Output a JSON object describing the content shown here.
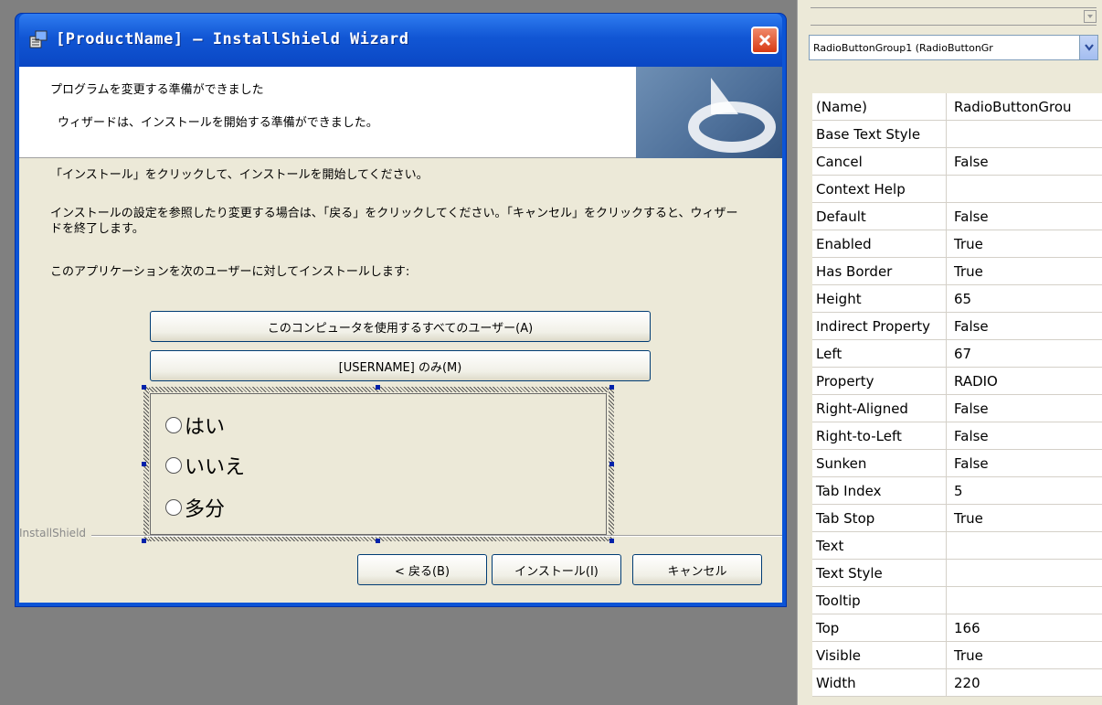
{
  "window": {
    "title": "[ProductName] – InstallShield Wizard"
  },
  "banner": {
    "title": "プログラムを変更する準備ができました",
    "subtitle": "ウィザードは、インストールを開始する準備ができました。"
  },
  "body": {
    "instruction1": "「インストール」をクリックして、インストールを開始してください。",
    "instruction2": "インストールの設定を参照したり変更する場合は、「戻る」をクリックしてください。「キャンセル」をクリックすると、ウィザードを終了します。",
    "instruction3": "このアプリケーションを次のユーザーに対してインストールします:"
  },
  "options": {
    "all_users": "このコンピュータを使用するすべてのユーザー(A)",
    "only_user": "[USERNAME] のみ(M)"
  },
  "radio_group": {
    "items": [
      "はい",
      "いいえ",
      "多分"
    ]
  },
  "brand": "InstallShield",
  "buttons": {
    "back": "< 戻る(B)",
    "install": "インストール(I)",
    "cancel": "キャンセル"
  },
  "property_grid": {
    "selected_object": "RadioButtonGroup1  (RadioButtonGr",
    "rows": [
      {
        "name": "(Name)",
        "value": "RadioButtonGrou"
      },
      {
        "name": "Base Text Style",
        "value": ""
      },
      {
        "name": "Cancel",
        "value": "False"
      },
      {
        "name": "Context Help",
        "value": ""
      },
      {
        "name": "Default",
        "value": "False"
      },
      {
        "name": "Enabled",
        "value": "True"
      },
      {
        "name": "Has Border",
        "value": "True"
      },
      {
        "name": "Height",
        "value": "65"
      },
      {
        "name": "Indirect Property",
        "value": "False"
      },
      {
        "name": "Left",
        "value": "67"
      },
      {
        "name": "Property",
        "value": "RADIO"
      },
      {
        "name": "Right-Aligned",
        "value": "False"
      },
      {
        "name": "Right-to-Left",
        "value": "False"
      },
      {
        "name": "Sunken",
        "value": "False"
      },
      {
        "name": "Tab Index",
        "value": "5"
      },
      {
        "name": "Tab Stop",
        "value": "True"
      },
      {
        "name": "Text",
        "value": ""
      },
      {
        "name": "Text Style",
        "value": ""
      },
      {
        "name": "Tooltip",
        "value": ""
      },
      {
        "name": "Top",
        "value": "166"
      },
      {
        "name": "Visible",
        "value": "True"
      },
      {
        "name": "Width",
        "value": "220"
      }
    ]
  }
}
